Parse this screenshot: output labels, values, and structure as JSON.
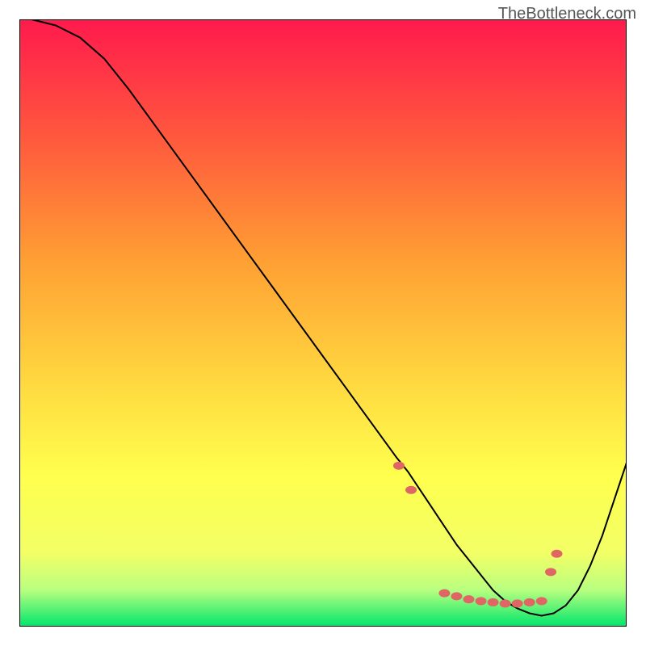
{
  "watermark": "TheBottleneck.com",
  "chart_data": {
    "type": "line",
    "title": "",
    "xlabel": "",
    "ylabel": "",
    "xlim": [
      0,
      100
    ],
    "ylim": [
      0,
      100
    ],
    "background": {
      "type": "vertical_gradient",
      "stops": [
        {
          "offset": 0.0,
          "color": "#ff1a4d"
        },
        {
          "offset": 0.2,
          "color": "#ff5a3d"
        },
        {
          "offset": 0.4,
          "color": "#ffa033"
        },
        {
          "offset": 0.6,
          "color": "#ffd940"
        },
        {
          "offset": 0.75,
          "color": "#ffff4d"
        },
        {
          "offset": 0.88,
          "color": "#f2ff66"
        },
        {
          "offset": 0.94,
          "color": "#b8ff80"
        },
        {
          "offset": 1.0,
          "color": "#00e66b"
        }
      ]
    },
    "series": [
      {
        "name": "bottleneck-curve",
        "color": "#000000",
        "width": 2,
        "x": [
          2,
          6,
          10,
          14,
          18,
          22,
          26,
          30,
          34,
          38,
          42,
          46,
          50,
          54,
          58,
          62,
          64,
          66,
          68,
          70,
          72,
          74,
          76,
          78,
          80,
          82,
          84,
          86,
          88,
          90,
          92,
          94,
          96,
          98,
          100
        ],
        "y": [
          100,
          99,
          97,
          93.5,
          88.5,
          83,
          77.5,
          72,
          66.5,
          61,
          55.5,
          50,
          44.5,
          39,
          33.5,
          28,
          25.5,
          22.5,
          19.5,
          16.5,
          13.5,
          11,
          8.5,
          6,
          4.2,
          3,
          2.2,
          1.8,
          2.2,
          3.5,
          6,
          10,
          15,
          21,
          27
        ]
      }
    ],
    "markers": {
      "color": "#e06666",
      "radius": 5,
      "points": [
        {
          "x": 62.5,
          "y": 26.5
        },
        {
          "x": 64.5,
          "y": 22.5
        },
        {
          "x": 70,
          "y": 5.5
        },
        {
          "x": 72,
          "y": 5.0
        },
        {
          "x": 74,
          "y": 4.5
        },
        {
          "x": 76,
          "y": 4.2
        },
        {
          "x": 78,
          "y": 4.0
        },
        {
          "x": 80,
          "y": 3.8
        },
        {
          "x": 82,
          "y": 3.8
        },
        {
          "x": 84,
          "y": 4.0
        },
        {
          "x": 86,
          "y": 4.2
        },
        {
          "x": 87.5,
          "y": 9.0
        },
        {
          "x": 88.5,
          "y": 12.0
        }
      ]
    }
  }
}
